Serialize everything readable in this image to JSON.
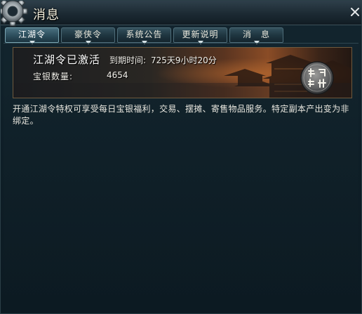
{
  "window": {
    "title": "消息",
    "icon": "gear-icon",
    "close_icon": "close-icon"
  },
  "tabs": [
    {
      "label": "江湖令",
      "active": true
    },
    {
      "label": "豪侠令",
      "active": false
    },
    {
      "label": "系统公告",
      "active": false
    },
    {
      "label": "更新说明",
      "active": false
    },
    {
      "label": "消　息",
      "active": false
    }
  ],
  "banner": {
    "title": "江湖令已激活",
    "expire_label": "到期时间:",
    "expire_value": "725天9小时20分",
    "silver_label": "宝银数量:",
    "silver_value": "4654",
    "seal_text": "每日福利"
  },
  "description": "开通江湖令特权可享受每日宝银福利，交易、摆摊、寄售物品服务。特定副本产出变为非绑定。",
  "colors": {
    "background": "#0c1820",
    "tab_active": "#2c4d5b",
    "banner_border": "#6f5a3e",
    "text": "#e9e7df"
  }
}
